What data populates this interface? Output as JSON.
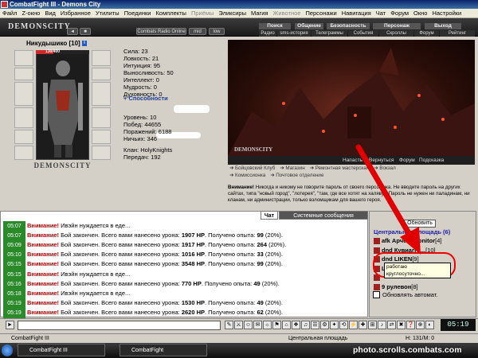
{
  "window": {
    "title": "CombatFight III - Demons City"
  },
  "menu": [
    "Файл",
    "Z-окно",
    "Вид",
    "Избранное",
    "Утилиты",
    "Поединки",
    "Комплекты",
    "Приёмы",
    "Эликсиры",
    "Магия",
    "Животное",
    "Персонажи",
    "Навигация",
    "Чат",
    "Форум",
    "Окно",
    "Настройки"
  ],
  "menu_disabled": [
    "Приёмы",
    "Животное"
  ],
  "banner": {
    "logo": "DEMONSCITY",
    "radio_label": "Combats Radio Online",
    "btn_mid": "mid",
    "btn_low": "low",
    "nav_tabs": [
      "Поиск",
      "Общение",
      "Безопасность",
      "Персонаж",
      "Выход"
    ],
    "nav_sub": [
      "Радио",
      "sms-история",
      "Телеграммы",
      "События",
      "Скроллы",
      "Форум",
      "Рейтинг"
    ]
  },
  "character": {
    "name": "Никудышико",
    "level": "[10]",
    "badge": "i",
    "hp": "130/400",
    "hp_fraction": 0.325,
    "emblem": "DEMONSCITY",
    "stats": [
      "Сила: 23",
      "Ловкость: 21",
      "Интуиция: 95",
      "Выносливость: 50",
      "Интеллект: 0",
      "Мудрость: 0",
      "Духовность: 0"
    ],
    "abilities_link": "+ Способности",
    "info": [
      "Уровень: 10",
      "Побед: 44655",
      "Поражений: 6188",
      "Ничьих: 346"
    ],
    "clan": "Клан: HolyKnights",
    "transfers": "Передач: 192"
  },
  "scene": {
    "logo": "DEMONSCITY",
    "actions": [
      "Напасть",
      "Вернуться",
      "Форум",
      "Подсказка"
    ],
    "links_row1": [
      "Бойцовский Клуб",
      "Магазин",
      "Ремонтная мастерская",
      "Вокзал"
    ],
    "links_row2": [
      "Комиссионка",
      "Почтовое отделение"
    ]
  },
  "warning": {
    "lead": "Внимание!",
    "text": "Никогда и никому не говорите пароль от своего персонажа. Не вводите пароль на других сайтах, типа \"новый город\", \"лотерея\", \"там, где все хотят на халяву\". Пароль не нужен ни паладинам, ни кланам, ни администрации, только взломщикам для вашего героя."
  },
  "chat": {
    "tabs": [
      "Чат",
      "Системные сообщения"
    ],
    "lines": [
      {
        "time": "05:07",
        "warn": "Внимание!",
        "text": "Ивэйн нуждается в еде..."
      },
      {
        "time": "05:07",
        "warn": "Внимание!",
        "text": "Бой закончен. Всего вами нанесено урона: ",
        "dmg": "1907 НР",
        "rest": ". Получено опыта: ",
        "exp": "99",
        "tail": " (20%)."
      },
      {
        "time": "05:09",
        "warn": "Внимание!",
        "text": "Бой закончен. Всего вами нанесено урона: ",
        "dmg": "1917 НР",
        "rest": ". Получено опыта: ",
        "exp": "264",
        "tail": " (20%)."
      },
      {
        "time": "05:10",
        "warn": "Внимание!",
        "text": "Бой закончен. Всего вами нанесено урона: ",
        "dmg": "1016 НР",
        "rest": ". Получено опыта: ",
        "exp": "33",
        "tail": " (20%)."
      },
      {
        "time": "05:15",
        "warn": "Внимание!",
        "text": "Бой закончен. Всего вами нанесено урона: ",
        "dmg": "3548 НР",
        "rest": ". Получено опыта: ",
        "exp": "99",
        "tail": " (20%)."
      },
      {
        "time": "05:15",
        "warn": "Внимание!",
        "text": "Ивэйн нуждается в еде..."
      },
      {
        "time": "05:16",
        "warn": "Внимание!",
        "text": "Бой закончен. Всего вами нанесено урона: ",
        "dmg": "770 НР",
        "rest": ". Получено опыта: ",
        "exp": "49",
        "tail": " (20%)."
      },
      {
        "time": "05:18",
        "warn": "Внимание!",
        "text": "Ивэйн нуждается в еде..."
      },
      {
        "time": "05:19",
        "warn": "Внимание!",
        "text": "Бой закончен. Всего вами нанесено урона: ",
        "dmg": "1530 НР",
        "rest": ". Получено опыта: ",
        "exp": "49",
        "tail": " (20%)."
      },
      {
        "time": "05:19",
        "warn": "Внимание!",
        "text": "Бой закончен. Всего вами нанесено урона: ",
        "dmg": "2620 НР",
        "rest": ". Получено опыта: ",
        "exp": "62",
        "tail": " (20%)."
      }
    ]
  },
  "right": {
    "refresh": "Обновить",
    "location": "Центральная площадь (6)",
    "users": [
      {
        "prefix": "afk",
        "name": "Арчем-monitor",
        "level": "[4]"
      },
      {
        "prefix": "",
        "name": "dnd Кувиагги...",
        "level": "[10]"
      },
      {
        "prefix": "",
        "name": "dnd LIKEN",
        "level": "[9]"
      },
      {
        "prefix": "",
        "name": "Ш",
        "level": ""
      },
      {
        "prefix": "",
        "name": "",
        "level": ""
      },
      {
        "prefix": "",
        "name": "9 рулевон",
        "level": "[8]"
      }
    ],
    "tooltip": [
      "работаю",
      "круглосуточно..."
    ],
    "auto_refresh": "Обновлять автомат."
  },
  "clock": "05:19",
  "status": {
    "left": "CombatFight III",
    "right": "Центральная площадь",
    "hp": "Н: 131/М: 0"
  },
  "taskbar": {
    "task1": "CombatFight III",
    "task2": "CombatFight"
  },
  "watermark": "photo.scrolls.combats.com",
  "colors": {
    "warn": "#c00000",
    "time_bg": "#2a8a2a",
    "link": "#1a3c9a",
    "location": "#1a1aa8"
  }
}
